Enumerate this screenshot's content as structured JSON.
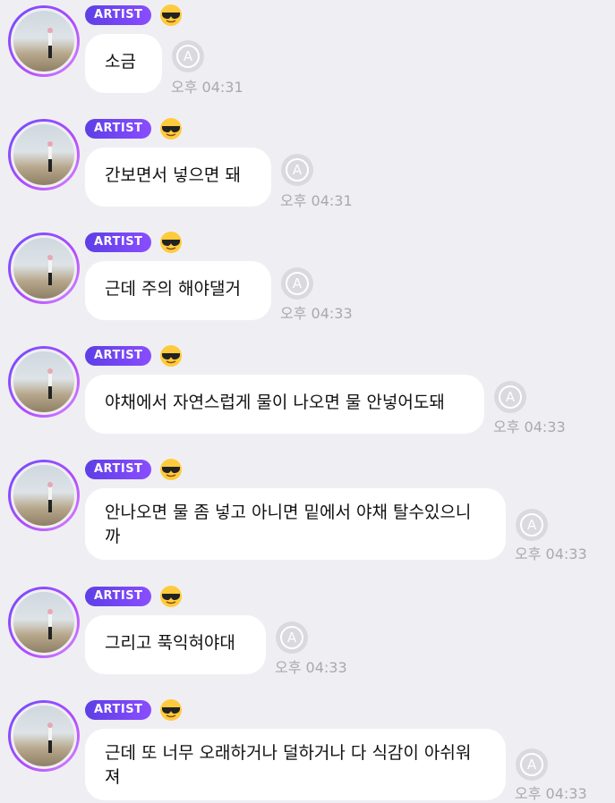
{
  "messages": [
    {
      "badge": "ARTIST",
      "text": "소금",
      "time": "오후 04:31"
    },
    {
      "badge": "ARTIST",
      "text": "간보면서 넣으면 돼",
      "time": "오후 04:31"
    },
    {
      "badge": "ARTIST",
      "text": "근데 주의 해야댈거",
      "time": "오후 04:33"
    },
    {
      "badge": "ARTIST",
      "text": "야채에서 자연스럽게 물이 나오면 물 안넣어도돼",
      "time": "오후 04:33"
    },
    {
      "badge": "ARTIST",
      "text": "안나오면 물 좀 넣고 아니면 밑에서 야채 탈수있으니까",
      "time": "오후 04:33"
    },
    {
      "badge": "ARTIST",
      "text": "그리고 푹익혀야대",
      "time": "오후 04:33"
    },
    {
      "badge": "ARTIST",
      "text": "근데 또 너무 오래하거나 덜하거나 다 식감이 아쉬워져",
      "time": "오후 04:33"
    }
  ],
  "colors": {
    "background": "#efeff3",
    "badge": "#6b46f0",
    "timestamp": "#a8a8ae"
  },
  "icons": {
    "badge_emoji": "sunglasses-emoji-icon",
    "translate": "translate-icon"
  }
}
